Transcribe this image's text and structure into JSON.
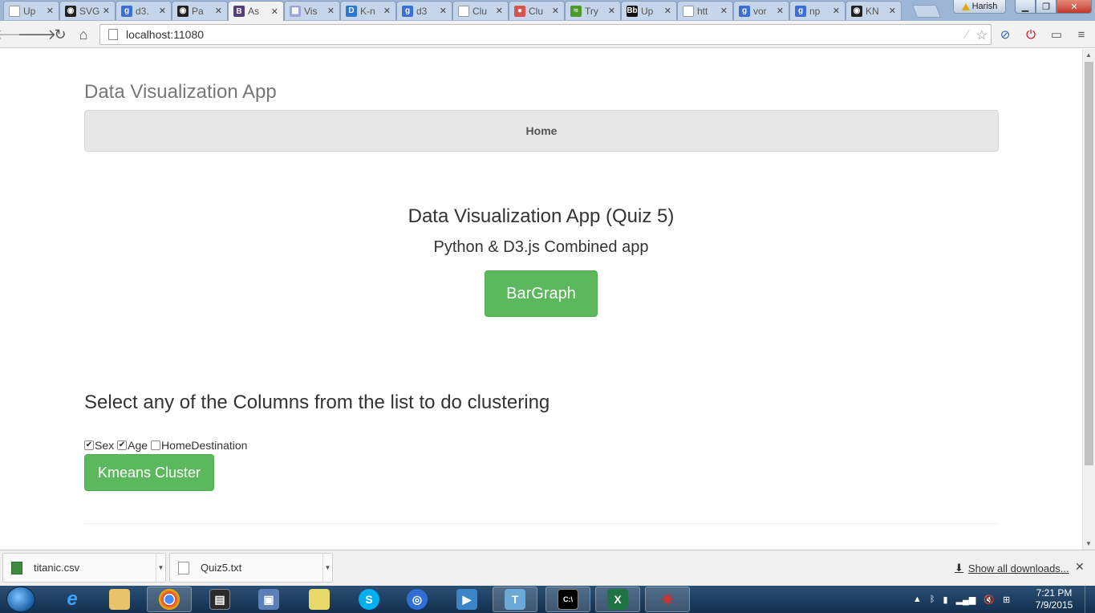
{
  "browser": {
    "tabs": [
      {
        "title": "Up",
        "fav_color": "#ffffff",
        "fav_glyph": "",
        "icon": "page-icon"
      },
      {
        "title": "SVG",
        "fav_color": "#222222",
        "fav_glyph": "◉",
        "icon": "github-icon"
      },
      {
        "title": "d3.",
        "fav_color": "#3b6fd6",
        "fav_glyph": "g",
        "icon": "google-icon"
      },
      {
        "title": "Pa",
        "fav_color": "#222222",
        "fav_glyph": "◉",
        "icon": "github-icon"
      },
      {
        "title": "As",
        "fav_color": "#563d7c",
        "fav_glyph": "B",
        "icon": "bootstrap-icon"
      },
      {
        "title": "Vis",
        "fav_color": "#9aa7d6",
        "fav_glyph": "▦",
        "icon": "vis-icon"
      },
      {
        "title": "K-n",
        "fav_color": "#2b78d0",
        "fav_glyph": "D",
        "icon": "d-icon"
      },
      {
        "title": "d3",
        "fav_color": "#3b6fd6",
        "fav_glyph": "g",
        "icon": "google-icon"
      },
      {
        "title": "Clu",
        "fav_color": "#ffffff",
        "fav_glyph": "",
        "icon": "page-icon"
      },
      {
        "title": "Clu",
        "fav_color": "#d9534f",
        "fav_glyph": "●",
        "icon": "cluster-icon"
      },
      {
        "title": "Try",
        "fav_color": "#4c9a2a",
        "fav_glyph": "≈",
        "icon": "try-icon"
      },
      {
        "title": "Up",
        "fav_color": "#111111",
        "fav_glyph": "Bb",
        "icon": "blackboard-icon"
      },
      {
        "title": "htt",
        "fav_color": "#ffffff",
        "fav_glyph": "",
        "icon": "page-icon"
      },
      {
        "title": "vor",
        "fav_color": "#3b6fd6",
        "fav_glyph": "g",
        "icon": "google-icon"
      },
      {
        "title": "np",
        "fav_color": "#3b6fd6",
        "fav_glyph": "g",
        "icon": "google-icon"
      },
      {
        "title": "KN",
        "fav_color": "#222222",
        "fav_glyph": "◉",
        "icon": "github-icon"
      }
    ],
    "active_tab_index": 4,
    "user_name": "Harish",
    "url": "localhost:11080"
  },
  "page": {
    "brand": "Data Visualization App",
    "nav_home": "Home",
    "hero_title": "Data Visualization App (Quiz 5)",
    "hero_subtitle": "Python & D3.js Combined app",
    "bargraph_button": "BarGraph",
    "section_title": "Select any of the Columns from the list to do clustering",
    "columns": [
      {
        "label": "Sex",
        "checked": true
      },
      {
        "label": "Age",
        "checked": true
      },
      {
        "label": "HomeDestination",
        "checked": false
      }
    ],
    "kmeans_button": "Kmeans Cluster",
    "accent_color": "#5cb85c"
  },
  "downloads": {
    "items": [
      {
        "name": "titanic.csv",
        "icon": "csv-file-icon"
      },
      {
        "name": "Quiz5.txt",
        "icon": "text-file-icon"
      }
    ],
    "show_all": "Show all downloads..."
  },
  "taskbar": {
    "time": "7:21 PM",
    "date": "7/9/2015"
  }
}
